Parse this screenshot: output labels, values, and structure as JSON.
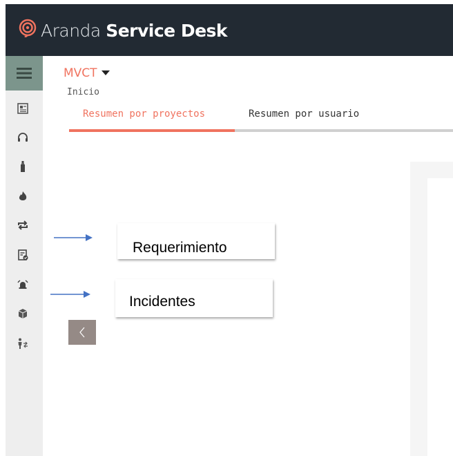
{
  "header": {
    "brand_light": "Aranda",
    "brand_bold": "Service Desk",
    "background": "#222a33",
    "logo_icon": "spiral-logo-icon"
  },
  "sidebar": {
    "toggle_icon": "hamburger-menu-icon",
    "toggle_color": "#7c958c",
    "items": [
      {
        "icon": "document-card-icon"
      },
      {
        "icon": "headset-icon"
      },
      {
        "icon": "bottle-icon"
      },
      {
        "icon": "flame-icon"
      },
      {
        "icon": "repeat-icon"
      },
      {
        "icon": "clipboard-check-icon"
      },
      {
        "icon": "alarm-bell-icon"
      },
      {
        "icon": "package-box-icon"
      },
      {
        "icon": "person-transfer-icon"
      }
    ]
  },
  "main": {
    "project": "MVCT",
    "breadcrumb": "Inicio",
    "tabs": [
      {
        "label": "Resumen por proyectos",
        "active": true
      },
      {
        "label": "Resumen por usuario",
        "active": false
      }
    ],
    "accent_color": "#f0735f",
    "collapse_icon": "chevron-left-icon"
  },
  "annotations": {
    "requerimiento": "Requerimiento",
    "incidentes": "Incidentes",
    "arrow_color": "#4472c4"
  }
}
